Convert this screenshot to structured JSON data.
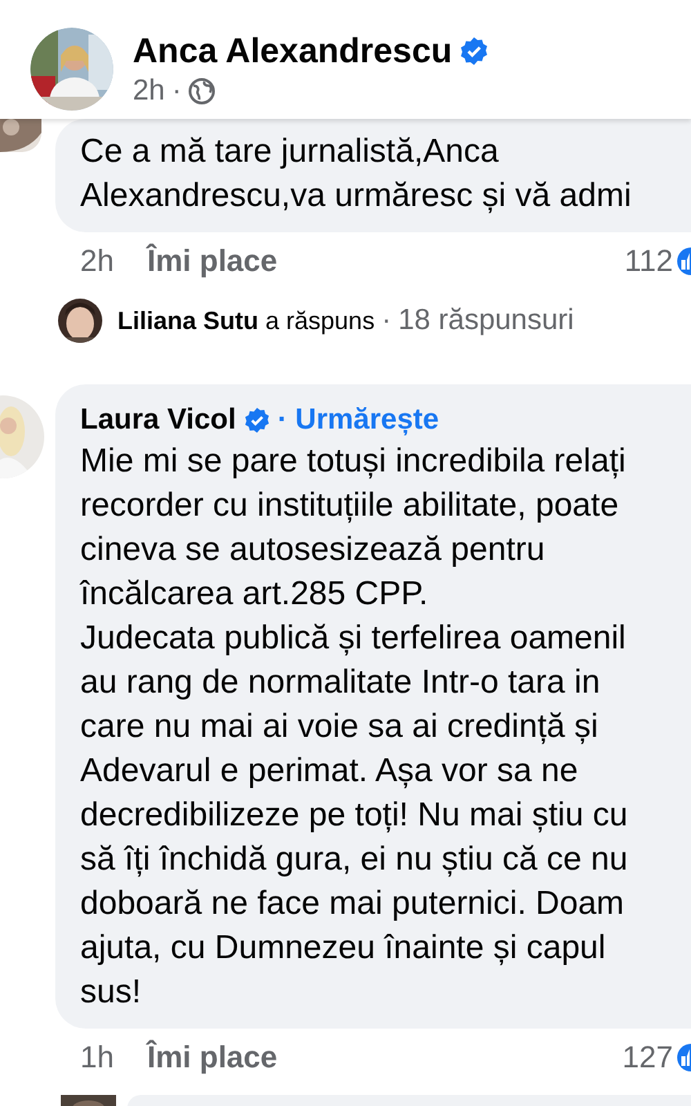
{
  "post_header": {
    "author": "Anca Alexandrescu",
    "verified": true,
    "time": "2h",
    "separator": "·"
  },
  "comments": [
    {
      "lines": [
        "Ce a mă tare jurnalistă,Anca",
        "Alexandrescu,va urmăresc și vă admi"
      ],
      "time": "2h",
      "like": "Îmi place",
      "reactions": "112",
      "reply_summary": {
        "name": "Liliana Sutu",
        "action": "a răspuns",
        "separator": "·",
        "count": "18 răspunsuri"
      }
    },
    {
      "author": "Laura Vicol",
      "verified": true,
      "follow": "· Urmărește",
      "lines": [
        "Mie mi se pare totuși incredibila relați",
        "recorder cu instituțiile abilitate, poate",
        "cineva se autosesizează pentru",
        "încălcarea art.285 CPP.",
        "Judecata publică și terfelirea oamenil",
        "au rang de normalitate Intr-o tara in",
        "care nu mai ai voie sa ai credință și",
        "Adevarul e perimat. Așa vor sa ne",
        "decredibilizeze pe toți! Nu mai știu cu",
        "să îți închidă gura, ei nu știu că ce nu",
        "doboară ne face mai puternici. Doam",
        "ajuta, cu Dumnezeu înainte și capul",
        "sus!"
      ],
      "time": "1h",
      "like": "Îmi place",
      "reactions": "127"
    }
  ]
}
